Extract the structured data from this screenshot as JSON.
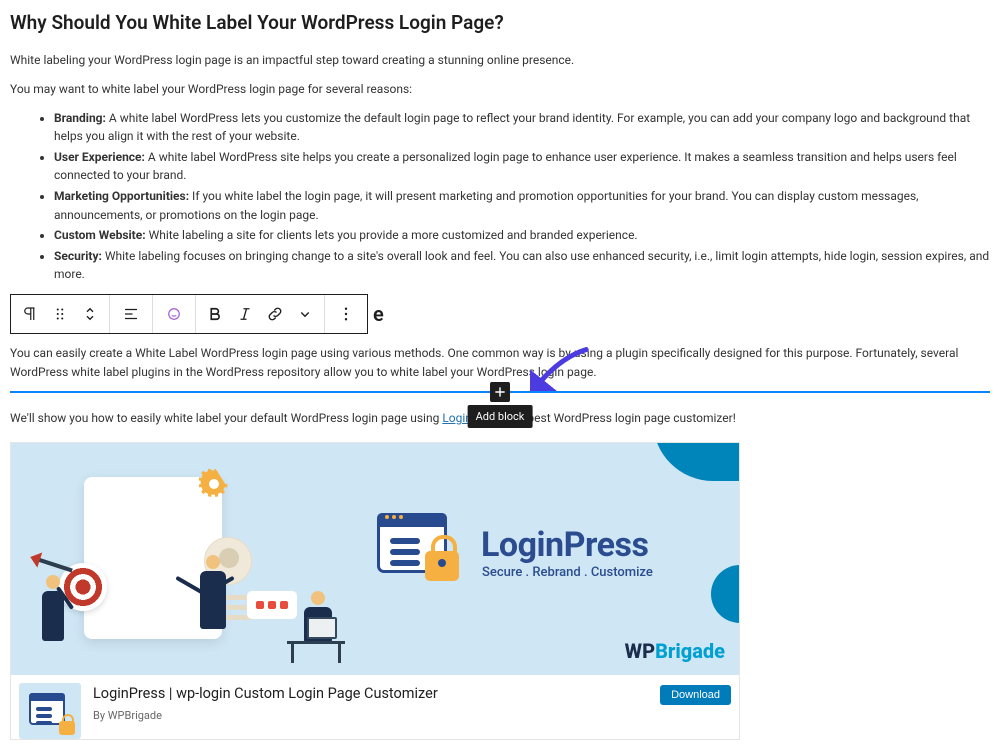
{
  "heading1": "Why Should You White Label Your WordPress Login Page?",
  "intro1": "White labeling your WordPress login page is an impactful step toward creating a stunning online presence.",
  "intro2": "You may want to white label your WordPress login page for several reasons:",
  "bullets": [
    {
      "term": "Branding:",
      "text": " A white label WordPress lets you customize the default login page to reflect your brand identity. For example, you can add your company logo and background that helps you align it with the rest of your website."
    },
    {
      "term": "User Experience:",
      "text": " A white label WordPress site helps you create a personalized login page to enhance user experience. It makes a seamless transition and helps users feel connected to your brand."
    },
    {
      "term": "Marketing Opportunities:",
      "text": " If you white label the login page, it will present marketing and promotion opportunities for your brand. You can display custom messages, announcements, or promotions on the login page."
    },
    {
      "term": "Custom Website:",
      "text": " White labeling a site for clients lets you provide a more customized and branded experience."
    },
    {
      "term": "Security:",
      "text": " White labeling focuses on bringing change to a site's overall look and feel. You can also use enhanced security, i.e., limit login attempts, hide login, session expires, and more."
    }
  ],
  "peek_heading_fragment": "e",
  "para_after_toolbar": {
    "pre": "You can easily create a White Label WordPress login page using various methods. One common way is by using a plugin specifically designed for this purpose.  Fortunately, several WordPress white label plugins in the WordPress repository allow you to white label your WordPress login ",
    "link_word": "page",
    "post": "."
  },
  "para3": {
    "pre": "We'll show you how to easily white label your default WordPress login page using ",
    "link": "LoginPress",
    "post": ", the best WordPress login page customizer!"
  },
  "add_block_tooltip": "Add block",
  "banner": {
    "logo": "LoginPress",
    "tagline": "Secure . Rebrand . Customize",
    "brand_wp": "WP",
    "brand_rest": "Brigade"
  },
  "plugin": {
    "title": "LoginPress | wp-login Custom Login Page Customizer",
    "by_prefix": "By ",
    "by": "WPBrigade",
    "download": "Download"
  }
}
